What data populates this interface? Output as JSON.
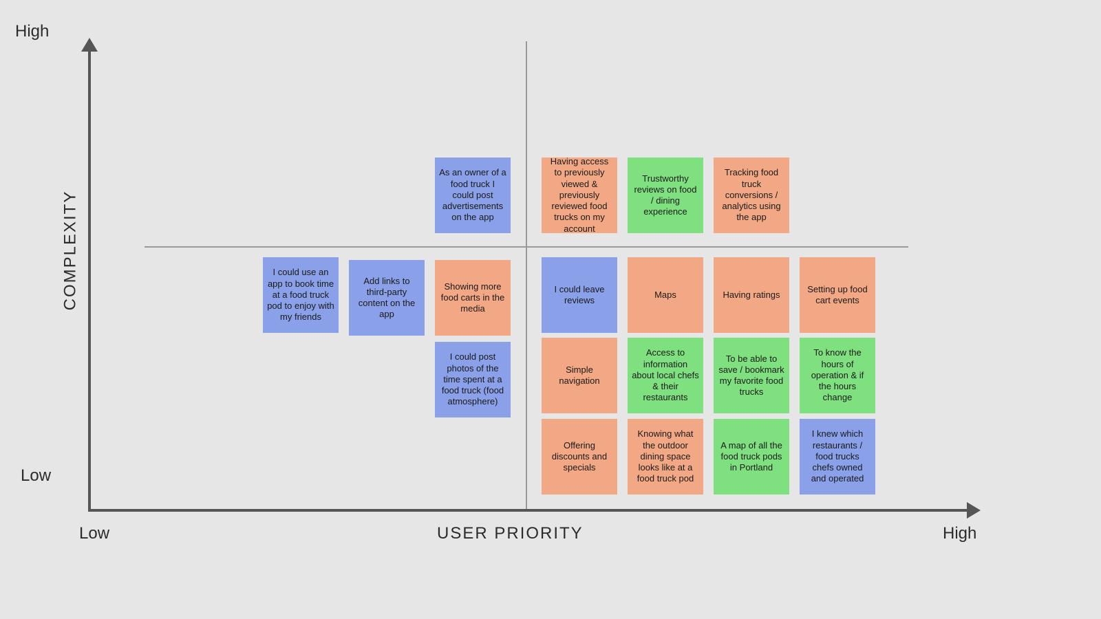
{
  "axis_labels": {
    "y_high": "High",
    "y_low": "Low",
    "x_low": "Low",
    "x_high": "High",
    "x_title": "USER PRIORITY",
    "y_title": "COMPLEXITY"
  },
  "cards": {
    "r1c1": "As an owner of a food truck I could post advertisements on the app",
    "r1c2": "Having access to previously viewed & previously reviewed food trucks on my account",
    "r1c3": "Trustworthy reviews on food / dining experience",
    "r1c4": "Tracking food truck conversions / analytics using the app",
    "r2a": "I could use an app to book time at a food truck pod to enjoy with my friends",
    "r2b": "Add links to third-party content on the app",
    "r2c": "Showing more food carts in the media",
    "r2d": "I could leave reviews",
    "r2e": "Maps",
    "r2f": "Having ratings",
    "r2g": "Setting up food cart events",
    "r3a": "I could post photos of the time spent at a food truck (food atmosphere)",
    "r3b": "Simple navigation",
    "r3c": "Access to information about local chefs & their restaurants",
    "r3d": "To be able to save / bookmark my favorite food trucks",
    "r3e": "To know the hours of operation & if the hours change",
    "r4a": "Offering discounts and specials",
    "r4b": "Knowing what the outdoor dining space looks like at a food truck pod",
    "r4c": "A map of all the food truck pods in Portland",
    "r4d": "I knew which restaurants / food trucks chefs owned and operated"
  }
}
